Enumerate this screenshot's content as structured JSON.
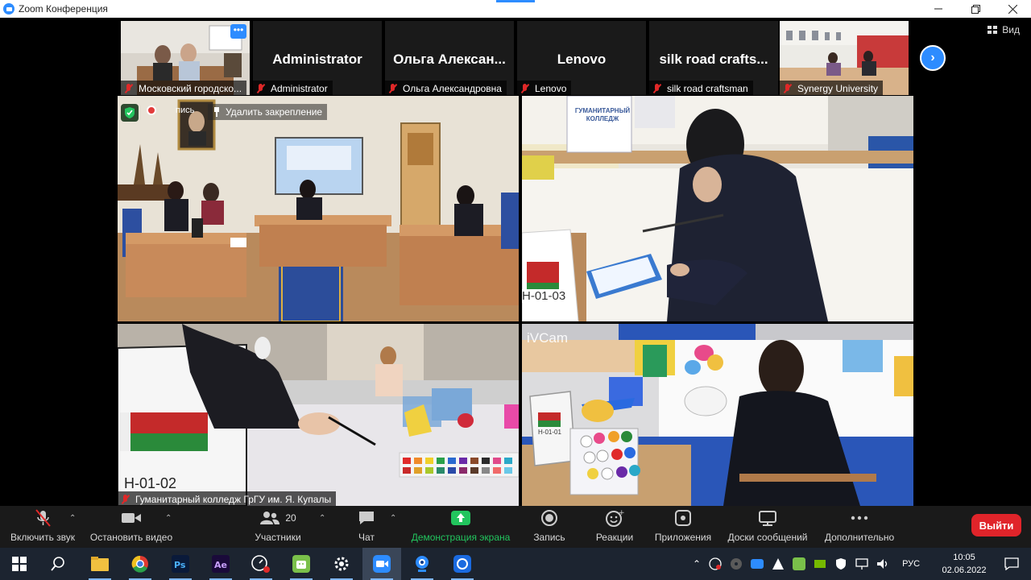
{
  "window": {
    "title": "Zoom Конференция"
  },
  "view_button": "Вид",
  "strip": [
    {
      "label": "Московский городско...",
      "type": "video"
    },
    {
      "name": "Administrator",
      "label": "Administrator"
    },
    {
      "name": "Ольга Алексан...",
      "label": "Ольга Александровна"
    },
    {
      "name": "Lenovo",
      "label": "Lenovo"
    },
    {
      "name": "silk road crafts...",
      "label": "silk road craftsman"
    },
    {
      "label": "Synergy University",
      "type": "video"
    }
  ],
  "main_video": {
    "recording_label": "пись",
    "unpin_label": "Удалить закрепление"
  },
  "tiles": {
    "bottom_left_label": "Гуманитарный колледж ГрГУ им. Я. Купалы",
    "bottom_right_watermark": "iVCam",
    "top_right_sign": "ГУМАНИТАРНЫЙ КОЛЛЕДЖ",
    "codes": [
      "Н-01-03",
      "Н-01-02",
      "Н-01-01"
    ]
  },
  "toolbar": {
    "mute": "Включить звук",
    "video": "Остановить видео",
    "participants": "Участники",
    "participants_count": "20",
    "chat": "Чат",
    "share": "Демонстрация экрана",
    "record": "Запись",
    "reactions": "Реакции",
    "apps": "Приложения",
    "whiteboards": "Доски сообщений",
    "more": "Дополнительно",
    "leave": "Выйти"
  },
  "taskbar": {
    "apps": [
      "windows-start",
      "search",
      "file-explorer",
      "chrome",
      "photoshop",
      "after-effects",
      "screen-recorder",
      "android-emulator",
      "settings",
      "zoom",
      "webcam",
      "zoom-meetings"
    ],
    "language": "РУС",
    "time": "10:05",
    "date": "02.06.2022"
  },
  "colors": {
    "accent": "#2d8cff",
    "share_green": "#22c55e",
    "leave_red": "#e0242a",
    "toolbar_bg": "#1a1a1a"
  }
}
